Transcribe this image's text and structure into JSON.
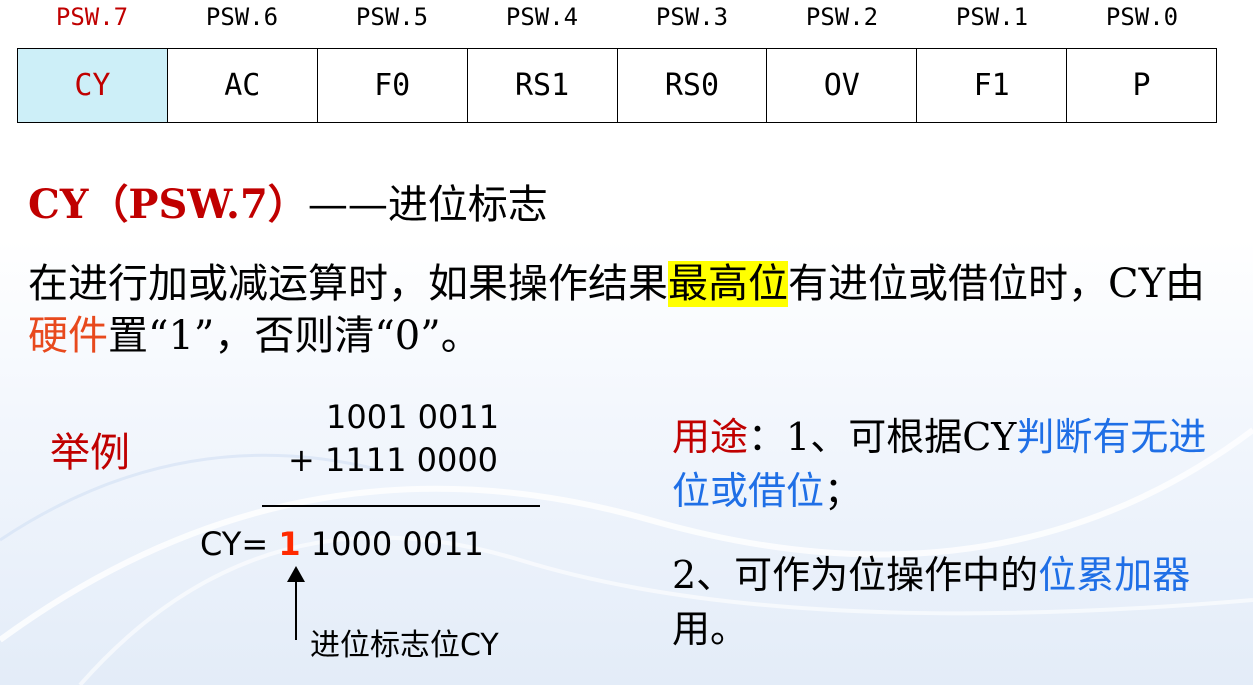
{
  "register": {
    "bit_labels": [
      "PSW.7",
      "PSW.6",
      "PSW.5",
      "PSW.4",
      "PSW.3",
      "PSW.2",
      "PSW.1",
      "PSW.0"
    ],
    "flags": [
      "CY",
      "AC",
      "F0",
      "RS1",
      "RS0",
      "OV",
      "F1",
      "P"
    ]
  },
  "heading": {
    "title": "CY（PSW.7）",
    "dash": "——",
    "desc": "进位标志"
  },
  "description": {
    "part1": "在进行加或减运算时，如果操作结果",
    "highlight": "最高位",
    "part2": "有进位或借位时，CY由",
    "hardware": "硬件",
    "part3": "置“1”，否则清“0”。"
  },
  "example": {
    "label": "举例",
    "line1": "1001 0011",
    "line2": "+ 1111 0000",
    "result_prefix": "CY= ",
    "carry_bit": "1",
    "result_rest": " 1000 0011",
    "carry_label_cn": "进位标志位",
    "carry_label_en": "CY"
  },
  "usage": {
    "label": "用途",
    "item1_a": "：1、可根据CY",
    "item1_blue": "判断有无进位或借位",
    "item1_end": "；",
    "item2_a": "2、可作为位操作中的",
    "item2_blue": "位累加器",
    "item2_end": "用。"
  },
  "colors": {
    "highlight_cell": "#cdeff8",
    "accent_red": "#c00000",
    "accent_blue": "#1f6fe6",
    "marker": "#ffff00"
  }
}
